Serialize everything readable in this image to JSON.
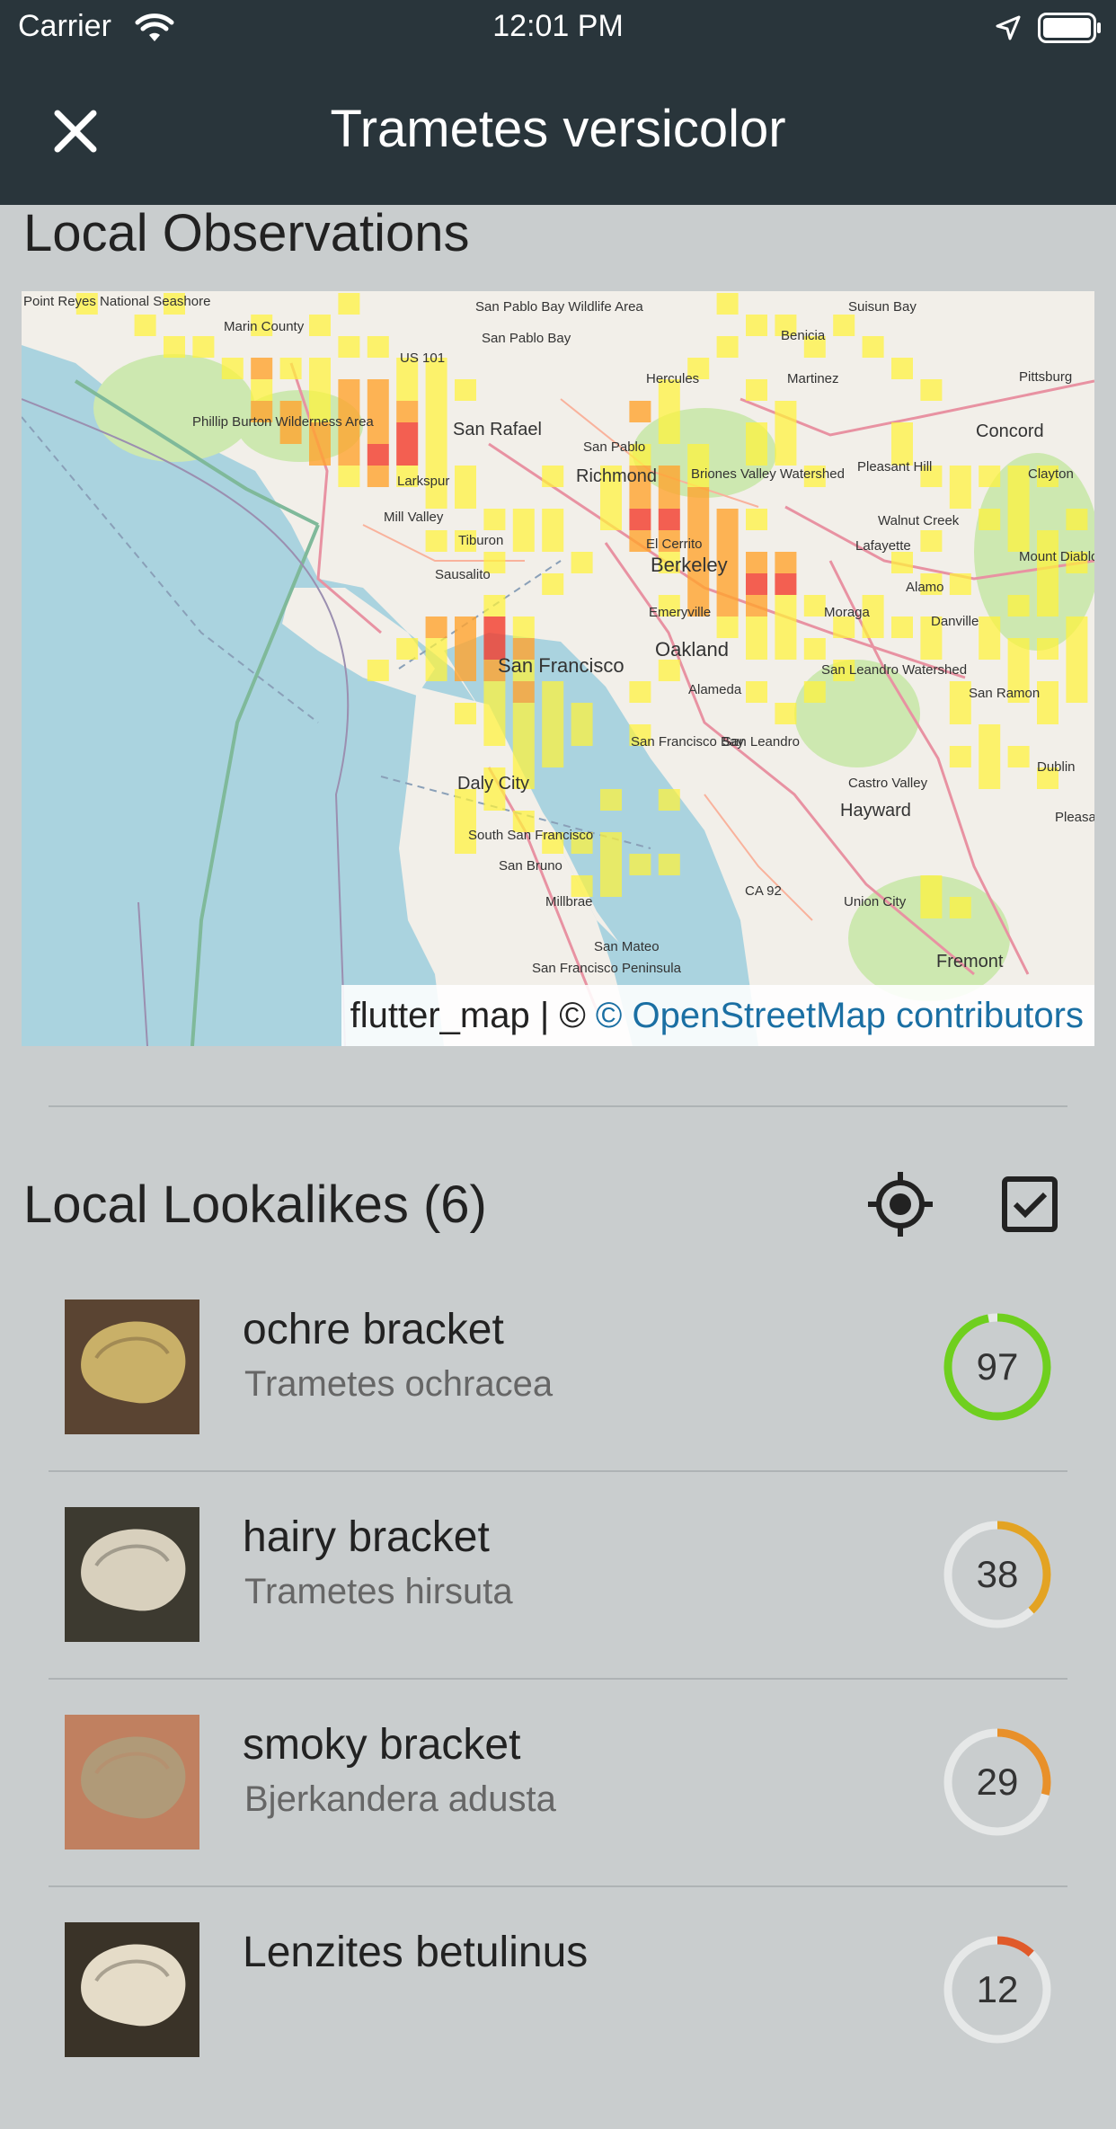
{
  "status_bar": {
    "carrier": "Carrier",
    "time": "12:01 PM"
  },
  "app_bar": {
    "title": "Trametes versicolor",
    "close_icon": "close-icon"
  },
  "observations": {
    "heading": "Local Observations",
    "attribution_prefix": "flutter_map | © ",
    "attribution_link": "© OpenStreetMap contributors",
    "map_labels": [
      "Point Reyes National Seashore",
      "Marin County",
      "San Pablo Bay Wildlife Area",
      "San Pablo Bay",
      "Suisun Bay",
      "Benicia",
      "US 101",
      "Hercules",
      "Martinez",
      "Pittsburg",
      "San Rafael",
      "Phillip Burton Wilderness Area",
      "Concord",
      "San Pablo",
      "Richmond",
      "Briones Valley Watershed",
      "Pleasant Hill",
      "Clayton",
      "Larkspur",
      "Mill Valley",
      "Tiburon",
      "Walnut Creek",
      "Lafayette",
      "Sausalito",
      "Berkeley",
      "El Cerrito",
      "Mount Diablo State Park",
      "Alamo",
      "Emeryville",
      "Moraga",
      "Danville",
      "Oakland",
      "San Francisco",
      "Alameda",
      "San Leandro Watershed",
      "San Ramon",
      "San Francisco Bay",
      "San Leandro",
      "Daly City",
      "Castro Valley",
      "Dublin",
      "Hayward",
      "Pleasanton",
      "South San Francisco",
      "San Bruno",
      "CA 92",
      "Millbrae",
      "Union City",
      "San Mateo",
      "San Francisco Peninsula",
      "Fremont"
    ]
  },
  "lookalikes": {
    "heading": "Local Lookalikes (6)",
    "locate_icon": "gps-target-icon",
    "checklist_icon": "checkbox-icon",
    "items": [
      {
        "name": "ochre bracket",
        "scientific": "Trametes ochracea",
        "score": "97",
        "score_fraction": 0.97,
        "color": "#6fcf1f",
        "photo_colors": [
          "#5a4432",
          "#c9b068"
        ]
      },
      {
        "name": "hairy bracket",
        "scientific": "Trametes hirsuta",
        "score": "38",
        "score_fraction": 0.38,
        "color": "#e3a323",
        "photo_colors": [
          "#3d3a30",
          "#d8d0bd"
        ]
      },
      {
        "name": "smoky bracket",
        "scientific": "Bjerkandera adusta",
        "score": "29",
        "score_fraction": 0.29,
        "color": "#e8902a",
        "photo_colors": [
          "#c08060",
          "#b09a78"
        ]
      },
      {
        "name": "Lenzites betulinus",
        "scientific": "",
        "score": "12",
        "score_fraction": 0.12,
        "color": "#e05a2a",
        "photo_colors": [
          "#3a3328",
          "#e5dcc8"
        ]
      }
    ]
  },
  "colors": {
    "app_bar": "#29353b",
    "background": "#c9cdce",
    "heat_low": "#fff23a",
    "heat_mid": "#ffa42e",
    "heat_high": "#f23b2b"
  }
}
